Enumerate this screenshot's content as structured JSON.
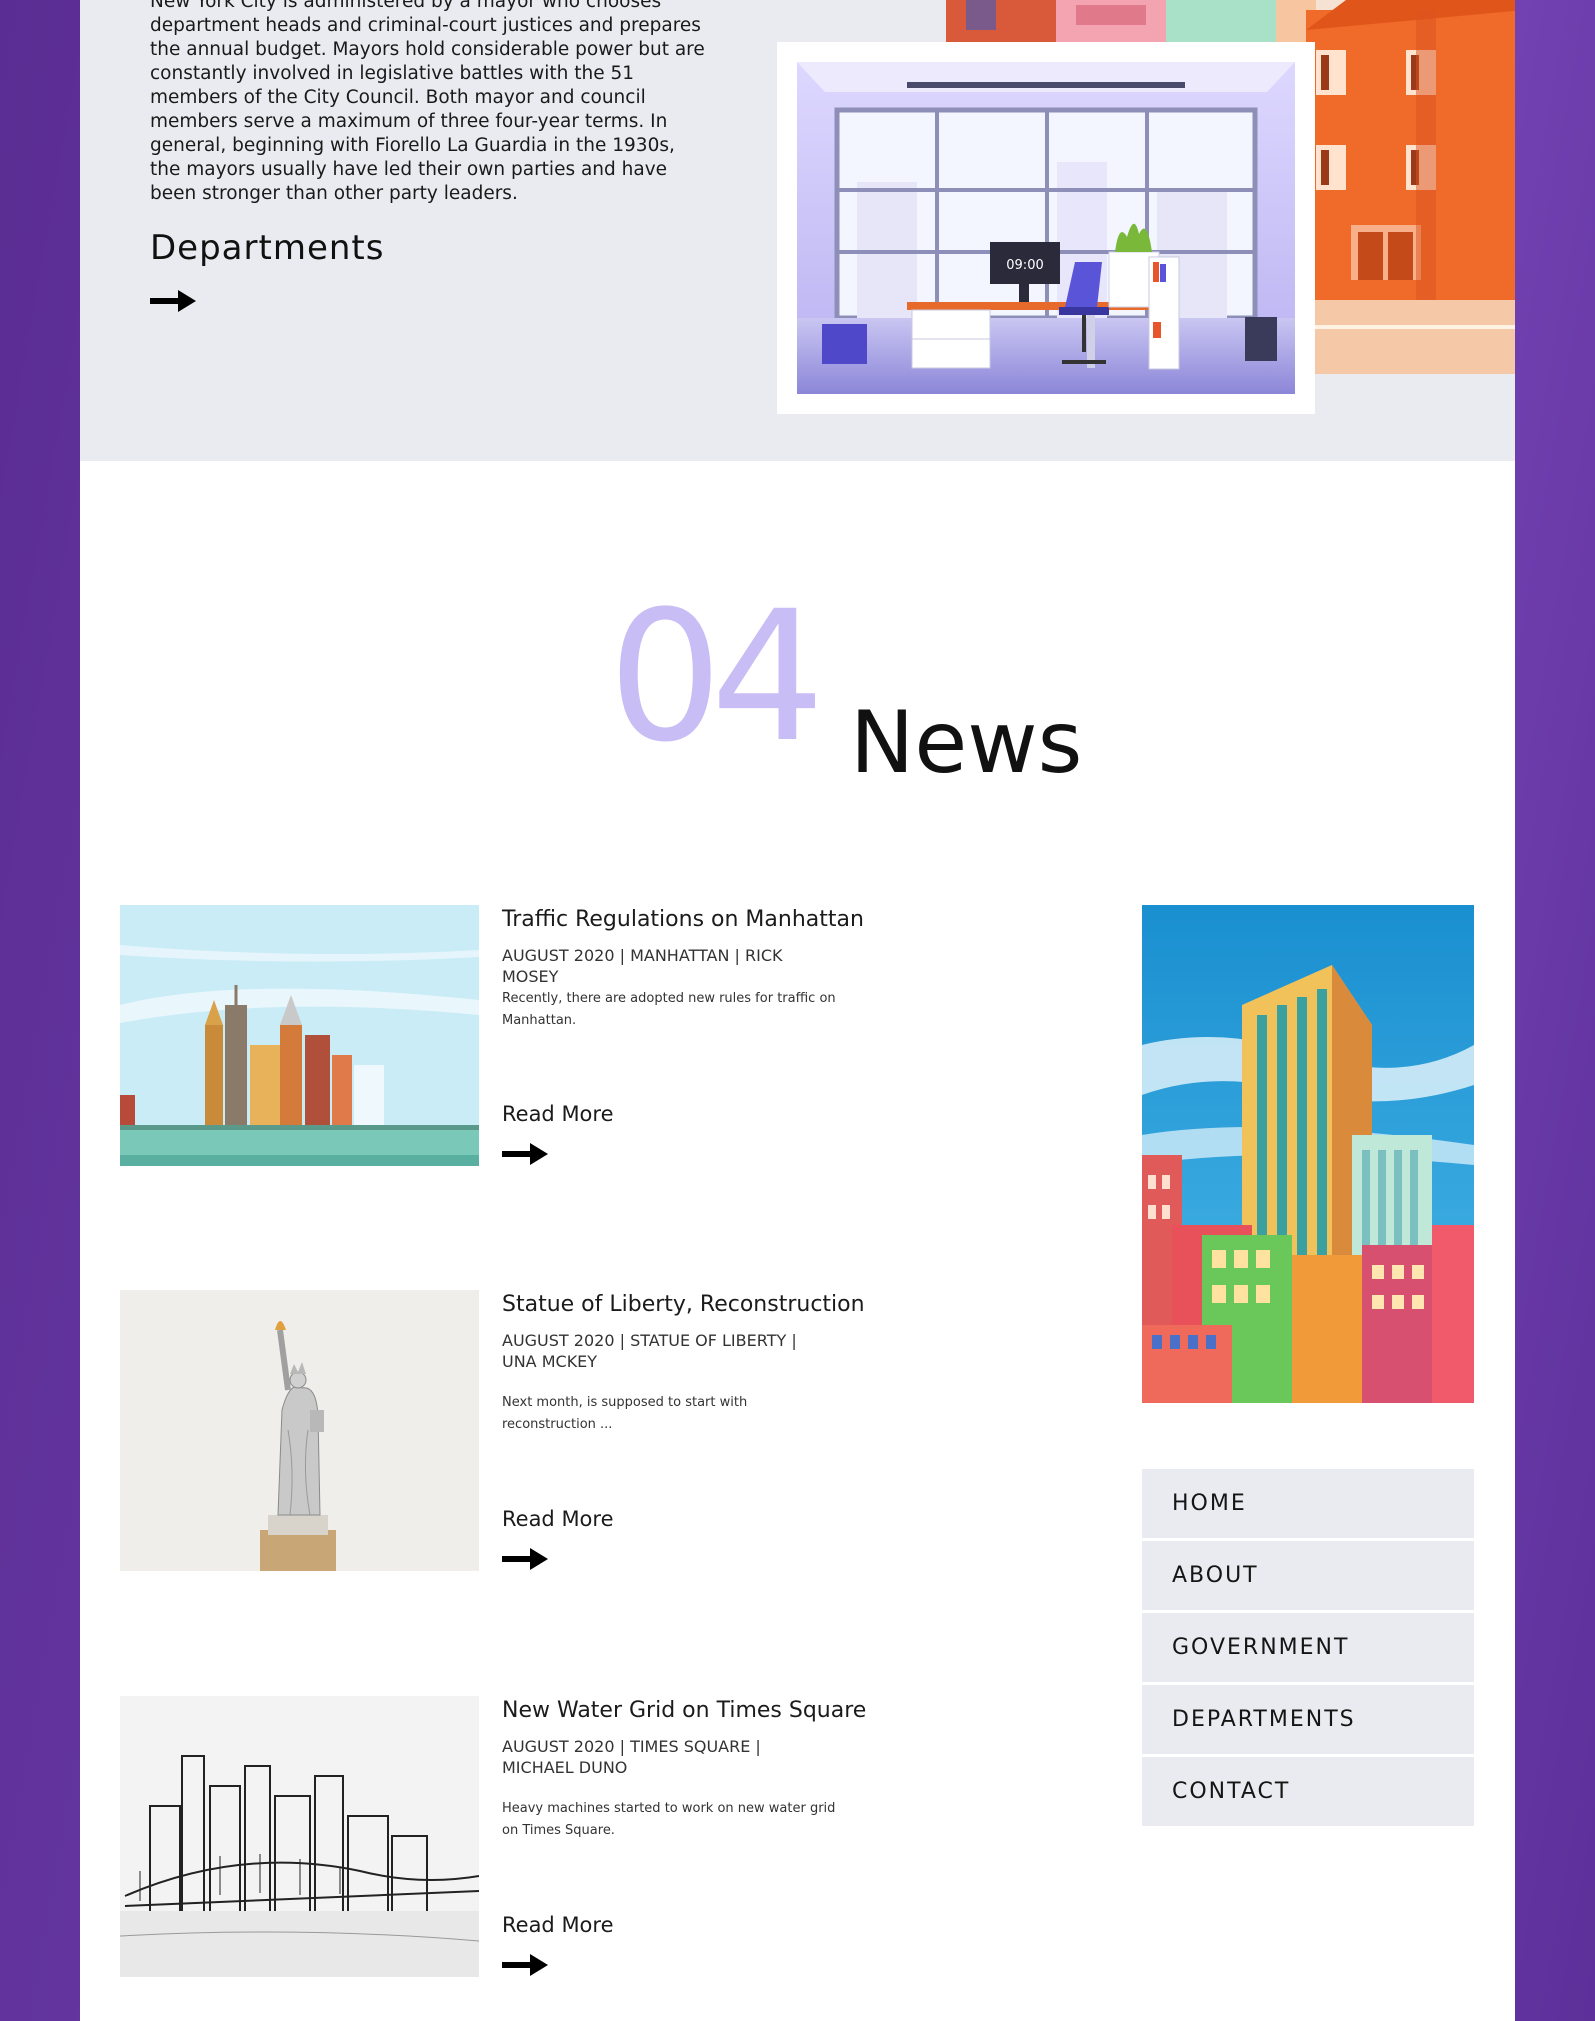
{
  "about": {
    "body": "New York City is administered by a mayor who chooses department heads and criminal-court justices and prepares the annual budget. Mayors hold considerable power but are constantly involved in legislative battles with the 51 members of the City Council. Both mayor and council members serve a maximum of three four-year terms. In general, beginning with Fiorello La Guardia in the 1930s, the mayors usually have led their own parties and have been stronger than other party leaders.",
    "departments_label": "Departments",
    "office_clock": "09:00"
  },
  "news": {
    "number": "04",
    "title": "News",
    "articles": [
      {
        "title": "Traffic Regulations on Manhattan",
        "meta": "AUGUST 2020 | MANHATTAN | RICK MOSEY",
        "excerpt": "Recently, there are adopted new rules for traffic on Manhattan.",
        "more": "Read More"
      },
      {
        "title": "Statue of Liberty, Reconstruction",
        "meta": "AUGUST 2020 | STATUE OF LIBERTY | UNA MCKEY",
        "excerpt": "Next month, is supposed to start with reconstruction ...",
        "more": "Read More"
      },
      {
        "title": "New Water Grid on Times Square",
        "meta": "AUGUST 2020 | TIMES SQUARE | MICHAEL DUNO",
        "excerpt": "Heavy machines started to work on new water grid on Times Square.",
        "more": "Read More"
      }
    ]
  },
  "menu": {
    "items": [
      "HOME",
      "ABOUT",
      "GOVERNMENT",
      "DEPARTMENTS",
      "CONTACT"
    ]
  },
  "colors": {
    "background_purple": "#6b3aa8",
    "section_gray": "#e9ebf0",
    "accent_lavender": "#c9bdf5"
  }
}
